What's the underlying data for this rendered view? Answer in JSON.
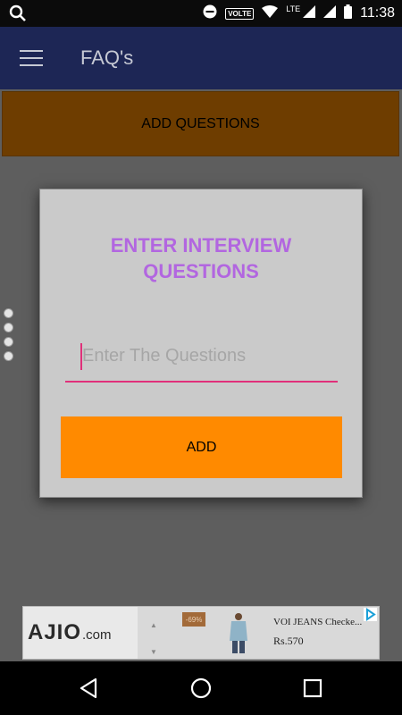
{
  "status_bar": {
    "volte": "VOLTE",
    "network": "LTE",
    "time": "11:38",
    "icons": [
      "search-icon",
      "do-not-disturb-icon",
      "wifi-icon",
      "signal-icon",
      "signal-icon",
      "battery-icon"
    ]
  },
  "app_bar": {
    "title": "FAQ's",
    "menu_icon": "hamburger-menu-icon",
    "background": "#1d2655"
  },
  "main": {
    "add_questions_label": "ADD QUESTIONS",
    "add_questions_color": "#6e3d00"
  },
  "dialog": {
    "title_line1": "ENTER INTERVIEW",
    "title_line2": "QUESTIONS",
    "title_color": "#b266e0",
    "input_placeholder": "Enter The Questions",
    "input_value": "",
    "accent_color": "#e0307a",
    "add_label": "ADD",
    "add_color": "#ff8a00"
  },
  "ad": {
    "brand_main": "AJIO",
    "brand_suffix": ".com",
    "discount": "-69%",
    "product_name": "VOI JEANS Checke...",
    "price": "Rs.570",
    "choices_icon": "adchoices-icon"
  },
  "nav_bar": {
    "icons": [
      "back-icon",
      "home-icon",
      "recents-icon"
    ]
  }
}
